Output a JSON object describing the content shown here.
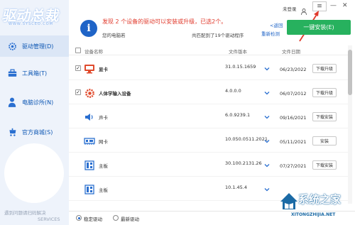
{
  "sidebar": {
    "logo": "驱动总裁",
    "logo_sub": "WWW.SYSCEO.COM",
    "items": [
      {
        "label": "驱动管理(D)",
        "icon": "gear-icon"
      },
      {
        "label": "工具箱(T)",
        "icon": "toolbox-icon"
      },
      {
        "label": "电脑诊所(N)",
        "icon": "doctor-icon"
      },
      {
        "label": "官方商城(S)",
        "icon": "cart-icon"
      }
    ],
    "help": "遇到问题请扫码解决",
    "services": "SERVICES"
  },
  "titlebar": {
    "login": "未登录",
    "menu": "≡",
    "minimize": "—",
    "close": "✕"
  },
  "banner": {
    "alert": "发现 2 个设备的驱动可以安装或升级，已选2个。",
    "pc_label": "您的电脑若",
    "match_text": "共匹配到了19个驱动程序",
    "back_link": "<返回",
    "redetect_link": "重新检测",
    "install_button": "一键安装(E)"
  },
  "table": {
    "headers": {
      "name": "设备名称",
      "version": "文件版本",
      "date": "文件日期"
    },
    "rows": [
      {
        "checked": "✓",
        "icon": "monitor-icon",
        "name": "显卡",
        "version": "31.0.15.1659",
        "date": "06/23/2022",
        "action": "下载升级"
      },
      {
        "checked": "✓",
        "icon": "gear-icon",
        "name": "人体学输入设备",
        "version": "4.0.0.0",
        "date": "06/07/2012",
        "action": "下载升级"
      },
      {
        "checked": "",
        "icon": "speaker-icon",
        "name": "声卡",
        "version": "6.0.9239.1",
        "date": "09/16/2021",
        "action": "下载安装"
      },
      {
        "checked": "",
        "icon": "network-card-icon",
        "name": "网卡",
        "version": "10.050.0511.2021",
        "date": "05/11/2021",
        "action": "安装"
      },
      {
        "checked": "",
        "icon": "motherboard-icon",
        "name": "主板",
        "version": "30.100.2131.26",
        "date": "07/27/2021",
        "action": "下载安装"
      },
      {
        "checked": "",
        "icon": "motherboard-icon",
        "name": "主板",
        "version": "10.1.45.4",
        "date": "",
        "action": ""
      }
    ]
  },
  "footer": {
    "option1": "稳定驱动",
    "option2": "最新驱动",
    "selected": "option1"
  },
  "watermark": {
    "title": "系统之家",
    "url": "XITONGZHIJIA.NET"
  },
  "colors": {
    "accent": "#1f64c7",
    "install": "#27b15e",
    "alert": "#e0392b",
    "sidebar_bg": "#eef3fb"
  }
}
